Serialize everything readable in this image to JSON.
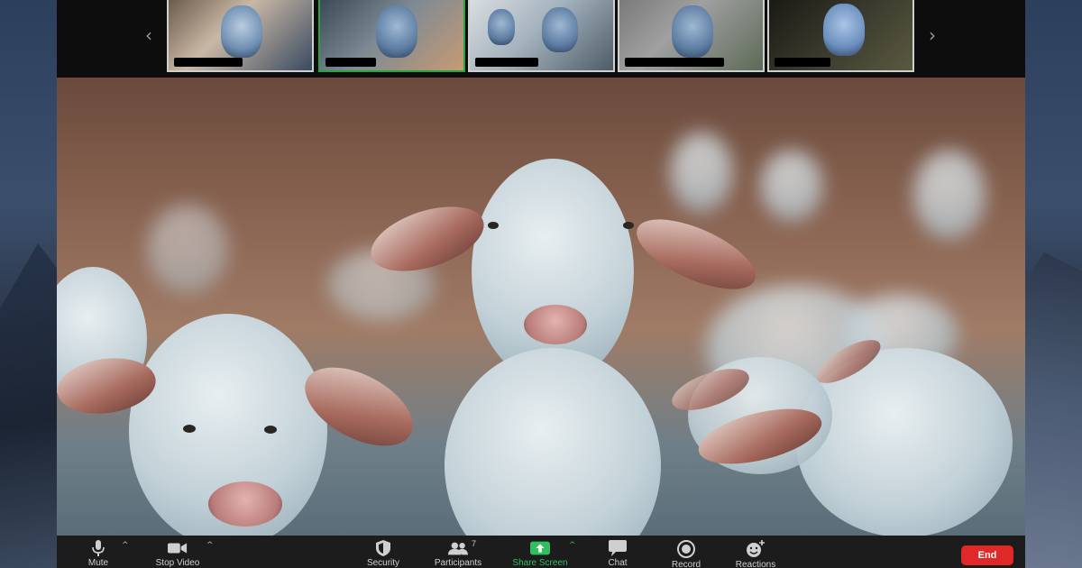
{
  "filmstrip": {
    "prev_arrow": "‹",
    "next_arrow": "›",
    "participants": [
      {
        "name": "",
        "active": false
      },
      {
        "name": "",
        "active": true
      },
      {
        "name": "",
        "active": false
      },
      {
        "name": "",
        "active": false
      },
      {
        "name": "",
        "active": false
      }
    ]
  },
  "toolbar": {
    "mute_label": "Mute",
    "stop_video_label": "Stop Video",
    "security_label": "Security",
    "participants_label": "Participants",
    "participants_count": "7",
    "share_screen_label": "Share Screen",
    "chat_label": "Chat",
    "record_label": "Record",
    "reactions_label": "Reactions",
    "end_label": "End",
    "caret": "^"
  },
  "colors": {
    "share_green": "#2fbf5f",
    "end_red": "#e02828",
    "active_speaker_border": "#26a543"
  }
}
